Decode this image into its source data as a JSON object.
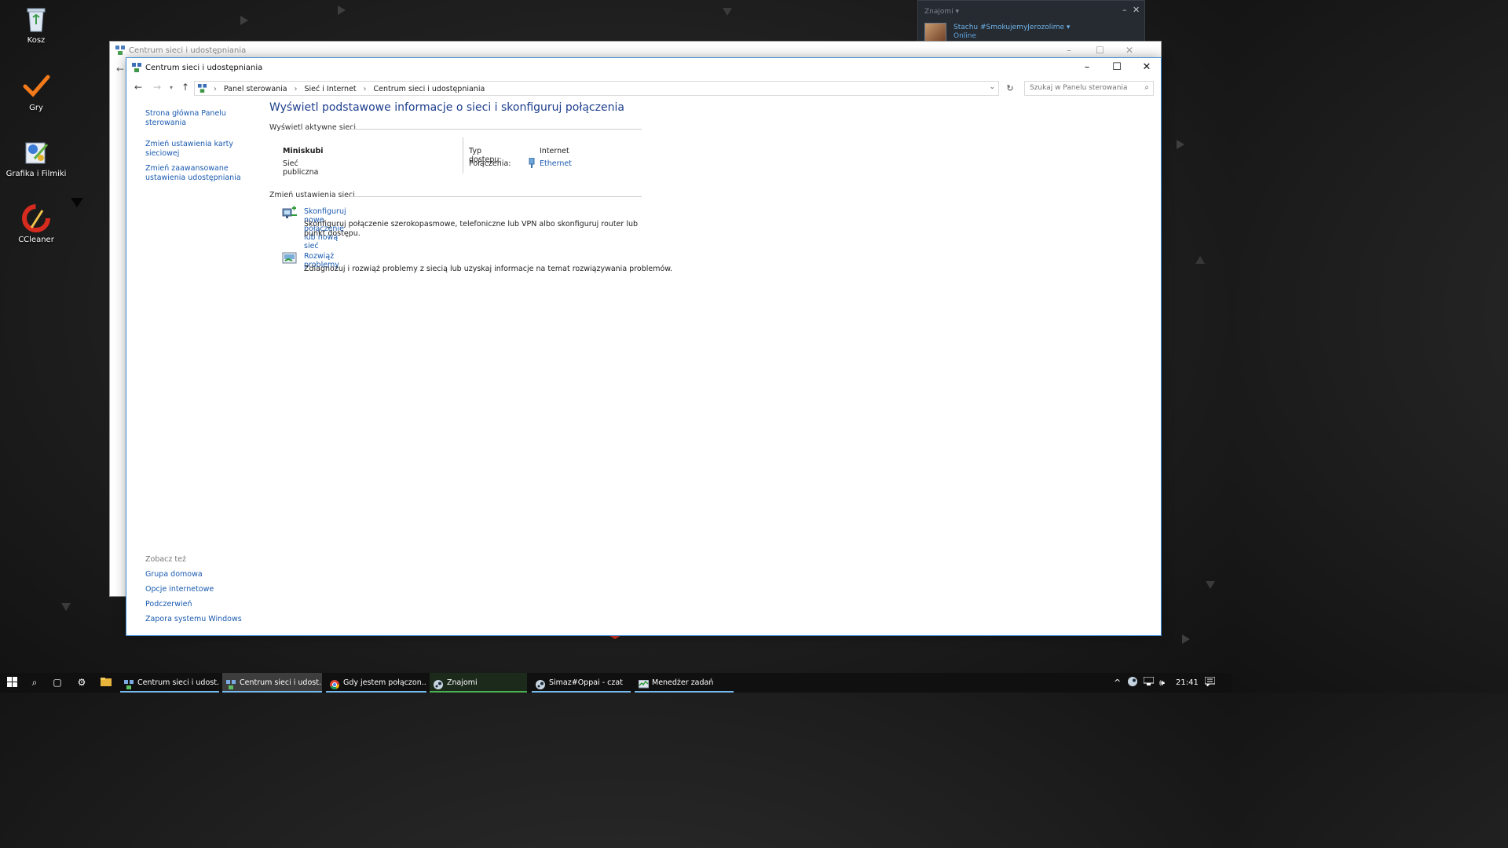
{
  "desktop": {
    "icons": [
      {
        "label": "Kosz",
        "icon": "recycle-bin-icon"
      },
      {
        "label": "Gry",
        "icon": "checkmark-icon"
      },
      {
        "label": "Grafika i Filmiki",
        "icon": "paint-app-icon"
      },
      {
        "label": "CCleaner",
        "icon": "ccleaner-icon"
      }
    ]
  },
  "steam_friends": {
    "header": "Znajomi",
    "username": "Stachu #SmokujemyJerozolime",
    "status": "Online"
  },
  "background_window": {
    "title": "Centrum sieci i udostępniania"
  },
  "window": {
    "title": "Centrum sieci i udostępniania",
    "breadcrumbs": [
      "Panel sterowania",
      "Sieć i Internet",
      "Centrum sieci i udostępniania"
    ],
    "search_placeholder": "Szukaj w Panelu sterowania"
  },
  "sidebar": {
    "links": [
      {
        "line1": "Strona główna Panelu",
        "line2": "sterowania"
      },
      {
        "line1": "Zmień ustawienia karty",
        "line2": "sieciowej"
      },
      {
        "line1": "Zmień zaawansowane",
        "line2": "ustawienia udostępniania"
      }
    ],
    "see_also_heading": "Zobacz też",
    "see_also": [
      "Grupa domowa",
      "Opcje internetowe",
      "Podczerwień",
      "Zapora systemu Windows"
    ]
  },
  "content": {
    "heading": "Wyświetl podstawowe informacje o sieci i skonfiguruj połączenia",
    "active_networks_label": "Wyświetl aktywne sieci",
    "network": {
      "name": "Miniskubi",
      "type": "Sieć publiczna",
      "access_type_label": "Typ dostępu:",
      "access_type_value": "Internet",
      "connections_label": "Połączenia:",
      "connections_value": "Ethernet"
    },
    "change_settings_label": "Zmień ustawienia sieci",
    "tasks": [
      {
        "link": "Skonfiguruj nowe połączenie lub nową sieć",
        "desc": "Skonfiguruj połączenie szerokopasmowe, telefoniczne lub VPN albo skonfiguruj router lub punkt dostępu."
      },
      {
        "link": "Rozwiąż problemy",
        "desc": "Zdiagnozuj i rozwiąż problemy z siecią lub uzyskaj informacje na temat rozwiązywania problemów."
      }
    ]
  },
  "taskbar": {
    "apps": [
      {
        "label": "Centrum sieci i udost...",
        "icon": "network-center-icon"
      },
      {
        "label": "Centrum sieci i udost...",
        "icon": "network-center-icon"
      },
      {
        "label": "Gdy jestem połączon...",
        "icon": "chrome-icon"
      },
      {
        "label": "Znajomi",
        "icon": "steam-icon"
      },
      {
        "label": "Simaz#Oppai - czat",
        "icon": "steam-icon"
      },
      {
        "label": "Menedżer zadań",
        "icon": "task-manager-icon"
      }
    ],
    "clock": "21:41"
  },
  "colors": {
    "link": "#1a5ab0",
    "heading": "#1e3f8e",
    "window_border": "#3b8ad8",
    "taskbar_accent": "#76b9ed"
  }
}
